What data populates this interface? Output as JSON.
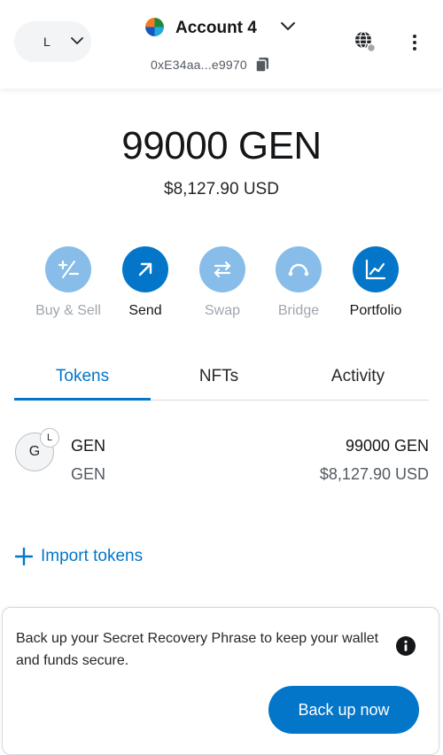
{
  "header": {
    "network_letter": "L",
    "account_name": "Account 4",
    "address": "0xE34aa...e9970"
  },
  "balance": {
    "primary": "99000 GEN",
    "secondary": "$8,127.90 USD"
  },
  "actions": [
    {
      "label": "Buy & Sell",
      "state": "muted",
      "icon": "plus-minus-icon"
    },
    {
      "label": "Send",
      "state": "active",
      "icon": "arrow-up-right-icon"
    },
    {
      "label": "Swap",
      "state": "muted",
      "icon": "swap-arrows-icon"
    },
    {
      "label": "Bridge",
      "state": "muted",
      "icon": "bridge-icon"
    },
    {
      "label": "Portfolio",
      "state": "active",
      "icon": "chart-icon"
    }
  ],
  "tabs": [
    {
      "label": "Tokens",
      "selected": true
    },
    {
      "label": "NFTs",
      "selected": false
    },
    {
      "label": "Activity",
      "selected": false
    }
  ],
  "tokens": [
    {
      "avatar_letter": "G",
      "network_badge": "L",
      "name": "GEN",
      "symbol": "GEN",
      "balance": "99000 GEN",
      "fiat": "$8,127.90 USD"
    }
  ],
  "import_tokens_label": "Import tokens",
  "backup": {
    "message": "Back up your Secret Recovery Phrase to keep your wallet and funds secure.",
    "button_label": "Back up now"
  },
  "colors": {
    "primary": "#0376c9",
    "primary_muted": "#87bde8",
    "text_muted": "#9fa6ae"
  }
}
